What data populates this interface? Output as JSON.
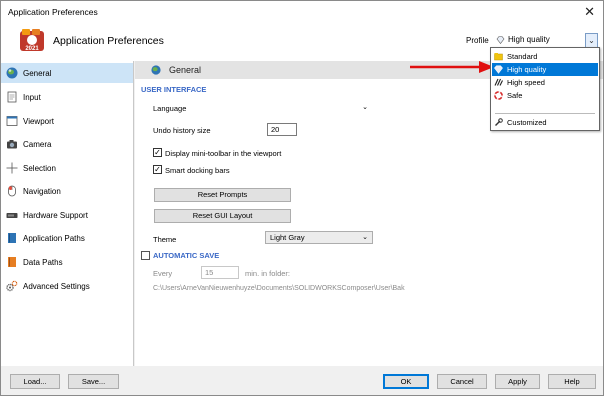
{
  "window": {
    "title": "Application Preferences",
    "close_glyph": "✕"
  },
  "header": {
    "app_title": "Application Preferences",
    "logo_icon": "composer-2021-logo-icon",
    "logo_text": "2021"
  },
  "profile": {
    "label": "Profile",
    "selected": "High quality",
    "dropdown_glyph": "⌄",
    "options": [
      {
        "label": "Standard",
        "icon": "folder-icon"
      },
      {
        "label": "High quality",
        "icon": "diamond-icon",
        "selected": true
      },
      {
        "label": "High speed",
        "icon": "speed-icon"
      },
      {
        "label": "Safe",
        "icon": "lifebuoy-icon"
      },
      {
        "label": "Customized",
        "icon": "wrench-icon"
      }
    ]
  },
  "sidebar": {
    "items": [
      {
        "label": "General",
        "icon": "globe-icon",
        "selected": true
      },
      {
        "label": "Input",
        "icon": "input-page-icon"
      },
      {
        "label": "Viewport",
        "icon": "viewport-icon"
      },
      {
        "label": "Camera",
        "icon": "camera-icon"
      },
      {
        "label": "Selection",
        "icon": "crosshair-icon"
      },
      {
        "label": "Navigation",
        "icon": "mouse-icon"
      },
      {
        "label": "Hardware Support",
        "icon": "hardware-icon"
      },
      {
        "label": "Application Paths",
        "icon": "book-icon"
      },
      {
        "label": "Data Paths",
        "icon": "data-book-icon"
      },
      {
        "label": "Advanced Settings",
        "icon": "gears-icon"
      }
    ]
  },
  "content": {
    "heading": "General",
    "user_interface": {
      "section_title": "USER INTERFACE",
      "language_label": "Language",
      "language_value": "",
      "language_arrow": "⌄",
      "undo_label": "Undo history size",
      "undo_value": "20",
      "mini_toolbar_label": "Display mini-toolbar in the viewport",
      "mini_toolbar_checked": true,
      "smart_docking_label": "Smart docking bars",
      "smart_docking_checked": true,
      "check_glyph": "✓",
      "reset_prompts": "Reset Prompts",
      "reset_gui": "Reset GUI Layout",
      "theme_label": "Theme",
      "theme_value": "Light Gray",
      "theme_arrow": "⌄"
    },
    "automatic_save": {
      "section_title": "AUTOMATIC SAVE",
      "checked": false,
      "every_label": "Every",
      "every_value": "15",
      "minutes_label": "min. in folder:",
      "folder_path": "C:\\Users\\ArneVanNieuwenhuyze\\Documents\\SOLIDWORKSComposer\\User\\Bak"
    }
  },
  "footer": {
    "load": "Load...",
    "save": "Save...",
    "ok": "OK",
    "cancel": "Cancel",
    "apply": "Apply",
    "help": "Help"
  },
  "colors": {
    "accent": "#0078d7",
    "section_title": "#3a68c6",
    "sidebar_selected": "#cde4f7",
    "annotation_arrow": "#e01010"
  }
}
